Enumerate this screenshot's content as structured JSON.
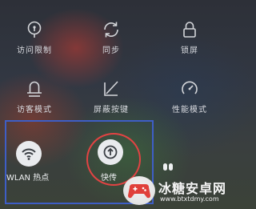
{
  "tiles": {
    "access_limit": {
      "label": "访问限制",
      "icon": "lock-question-icon"
    },
    "sync": {
      "label": "同步",
      "icon": "sync-icon"
    },
    "lock_screen": {
      "label": "锁屏",
      "icon": "padlock-icon"
    },
    "guest_mode": {
      "label": "访客模式",
      "icon": "guest-icon"
    },
    "hide_nav": {
      "label": "屏蔽按键",
      "icon": "nav-block-icon"
    },
    "performance": {
      "label": "性能模式",
      "icon": "speedometer-icon"
    },
    "wlan_hotspot": {
      "label": "WLAN 热点",
      "icon": "hotspot-icon"
    },
    "kuaichuan": {
      "label": "快传",
      "icon": "share-upload-icon"
    }
  },
  "highlight": {
    "box_color": "#3e5ec6",
    "ring_color": "#e24343"
  },
  "watermark": {
    "name": "冰糖安卓网",
    "url": "www.btxtdmy.com"
  }
}
